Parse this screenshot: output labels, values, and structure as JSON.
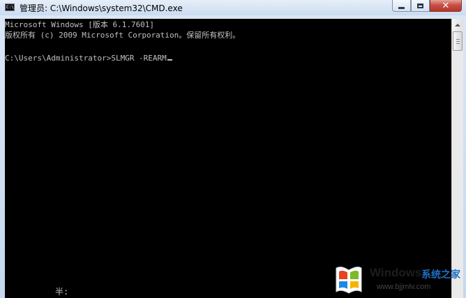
{
  "window": {
    "title": "管理员: C:\\Windows\\system32\\CMD.exe",
    "icon": "cmd-icon",
    "controls": {
      "minimize": "minimize-icon",
      "maximize": "maximize-icon",
      "close_label": "✕"
    }
  },
  "console": {
    "lines": [
      "Microsoft Windows [版本 6.1.7601]",
      "版权所有 (c) 2009 Microsoft Corporation。保留所有权利。",
      "C:\\Users\\Administrator>SLMGR -REARM"
    ],
    "ime_status": "半:",
    "colors": {
      "background": "#000000",
      "text": "#c0c0c0"
    }
  },
  "watermark": {
    "brand": "Windows",
    "brand_cn": "系统之家",
    "url": "www.bjjmlv.com",
    "logo_colors": [
      "#e8431f",
      "#7cba2a",
      "#1e88e5",
      "#f6b400"
    ]
  }
}
